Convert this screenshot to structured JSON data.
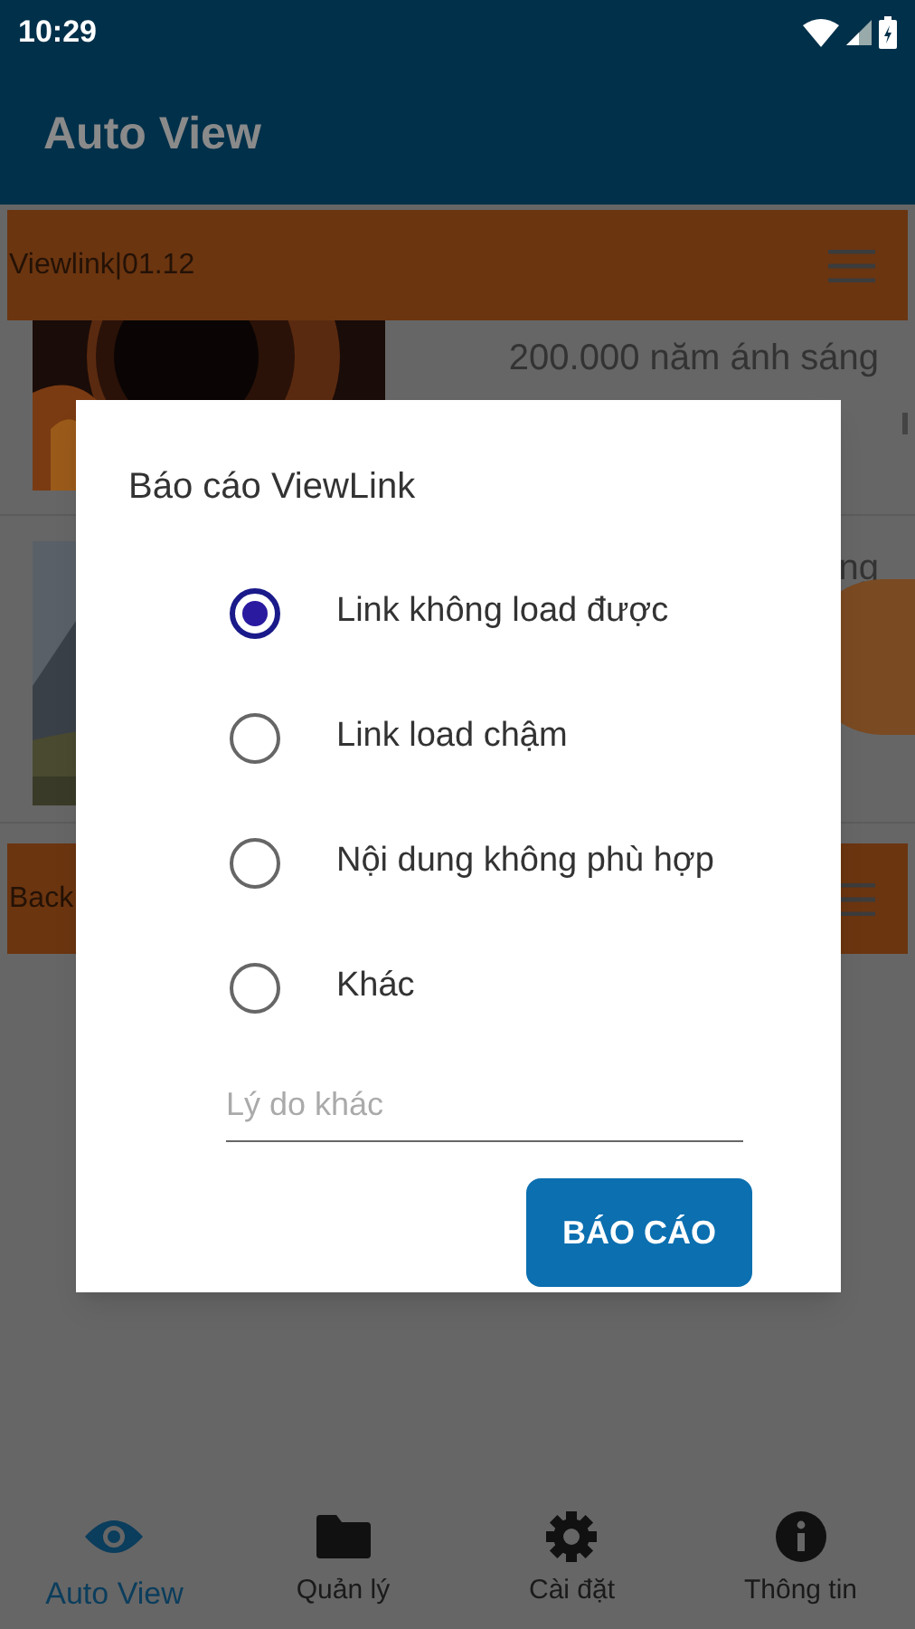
{
  "status_bar": {
    "time": "10:29"
  },
  "app_bar": {
    "title": "Auto View"
  },
  "list": {
    "header": "Viewlink|01.12",
    "items": [
      {
        "kind": "picture",
        "text": "200.000 năm ánh sáng"
      },
      {
        "kind": "picture",
        "text": "ng"
      }
    ],
    "next_header": "Back"
  },
  "dialog": {
    "title": "Báo cáo ViewLink",
    "options": [
      {
        "label": "Link không load được",
        "selected": true
      },
      {
        "label": "Link load chậm",
        "selected": false
      },
      {
        "label": "Nội dung không phù hợp",
        "selected": false
      },
      {
        "label": "Khác",
        "selected": false
      }
    ],
    "reason_field": {
      "placeholder": "Lý do khác"
    },
    "button": "BÁO CÁO"
  },
  "bottom_nav": [
    {
      "label": "Auto View",
      "kind": "eye",
      "selected": true
    },
    {
      "label": "Quản lý",
      "kind": "folder",
      "selected": false
    },
    {
      "label": "Cài đặt",
      "kind": "gear",
      "selected": false
    },
    {
      "label": "Thông tin",
      "kind": "info",
      "selected": false
    }
  ]
}
